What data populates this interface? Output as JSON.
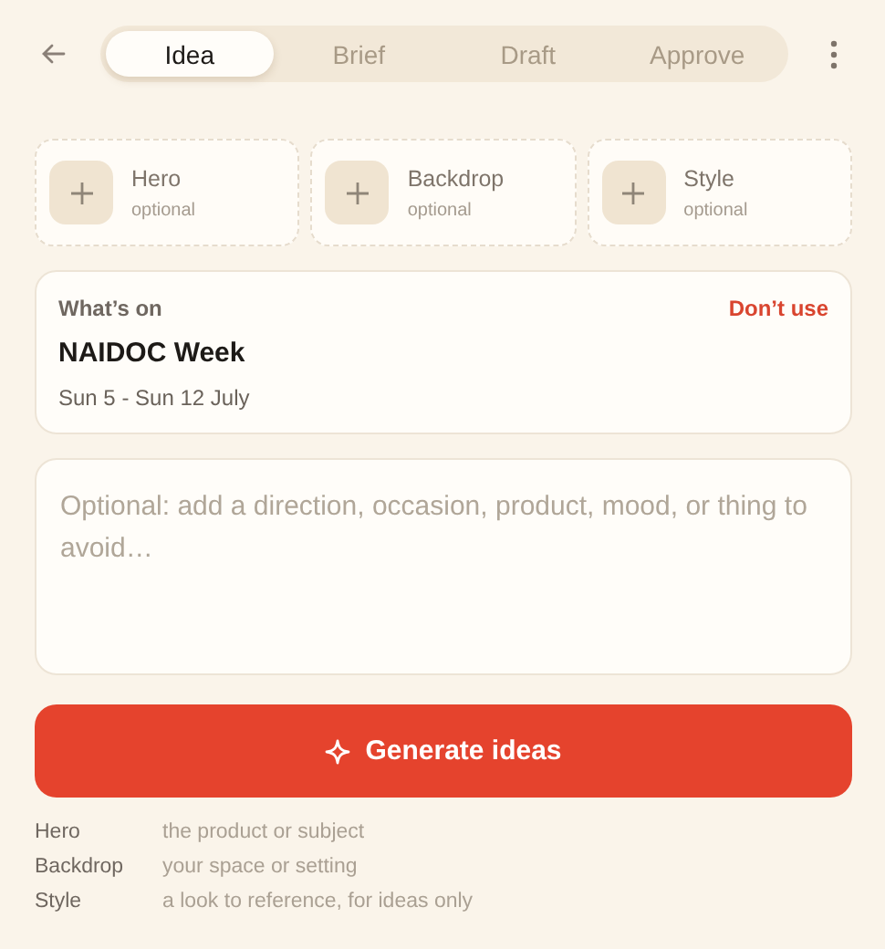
{
  "tabs": [
    {
      "label": "Idea",
      "selected": true
    },
    {
      "label": "Brief",
      "selected": false
    },
    {
      "label": "Draft",
      "selected": false
    },
    {
      "label": "Approve",
      "selected": false
    }
  ],
  "slots": [
    {
      "label": "Hero",
      "hint": "optional"
    },
    {
      "label": "Backdrop",
      "hint": "optional"
    },
    {
      "label": "Style",
      "hint": "optional"
    }
  ],
  "event": {
    "heading": "What’s on",
    "action": "Don’t use",
    "title": "NAIDOC Week",
    "dates": "Sun 5 - Sun 12 July"
  },
  "prompt": {
    "placeholder": "Optional: add a direction, occasion, product, mood, or thing to avoid…"
  },
  "generate_button": "Generate ideas",
  "legend": [
    {
      "term": "Hero",
      "description": "the product or subject"
    },
    {
      "term": "Backdrop",
      "description": "your space or setting"
    },
    {
      "term": "Style",
      "description": "a look to reference, for ideas only"
    }
  ]
}
